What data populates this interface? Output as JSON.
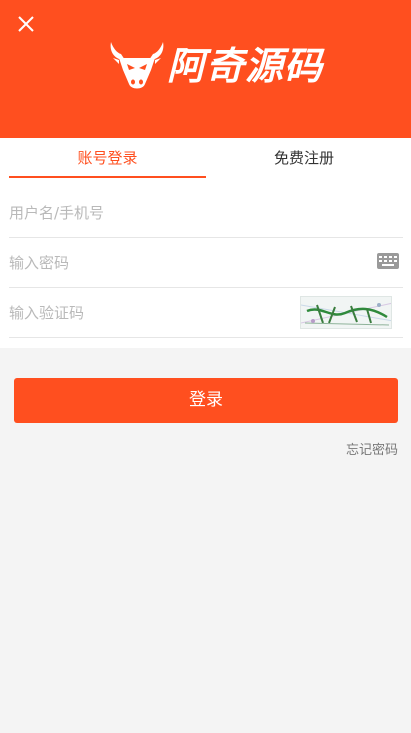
{
  "header": {
    "brand_name": "阿奇源码",
    "close_icon": "close-icon",
    "logo_icon": "bull-head-icon",
    "background_color": "#ff4f1f"
  },
  "tabs": [
    {
      "label": "账号登录",
      "active": true
    },
    {
      "label": "免费注册",
      "active": false
    }
  ],
  "form": {
    "username_placeholder": "用户名/手机号",
    "password_placeholder": "输入密码",
    "captcha_placeholder": "输入验证码",
    "keyboard_icon": "keyboard-icon",
    "captcha_image": "captcha-image"
  },
  "actions": {
    "login_label": "登录",
    "forgot_label": "忘记密码"
  },
  "colors": {
    "accent": "#ff4f1f",
    "page_bg": "#f4f4f4"
  }
}
